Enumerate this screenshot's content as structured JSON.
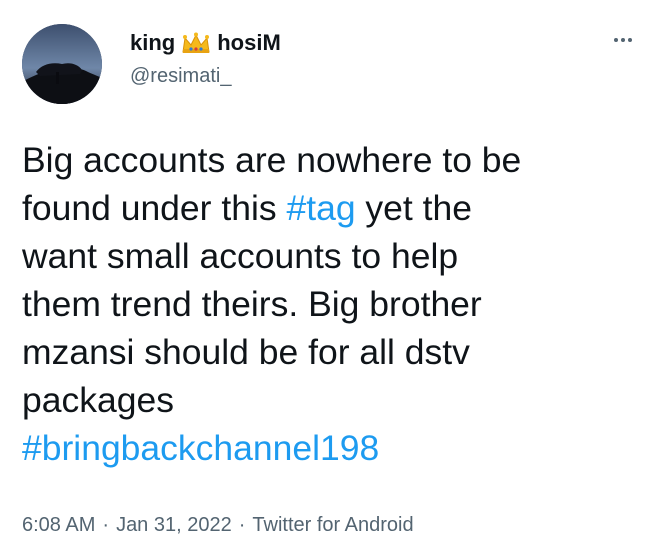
{
  "author": {
    "name_first": "king",
    "name_icon": "crown-emoji",
    "name_last": "hosiM",
    "handle": "@resimati_"
  },
  "menu": {
    "icon": "more-horizontal-icon"
  },
  "tweet": {
    "text_lines": [
      "Big accounts are nowhere to be",
      "found under this ",
      "#tag",
      " yet the",
      "want small accounts to help",
      "them trend theirs. Big brother",
      "mzansi should be for all dstv",
      "packages",
      "#bringbackchannel198"
    ]
  },
  "meta": {
    "time": "6:08 AM",
    "date": "Jan 31, 2022",
    "source": "Twitter for Android",
    "separator": "·"
  }
}
